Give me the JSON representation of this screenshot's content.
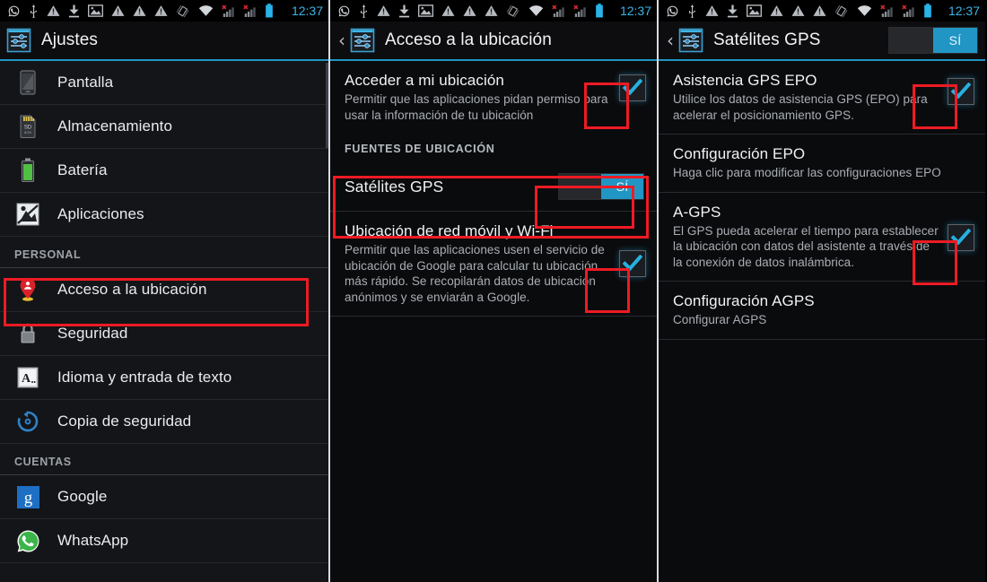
{
  "statusbar": {
    "time": "12:37",
    "icons": [
      "whatsapp-icon",
      "usb-icon",
      "warning-icon",
      "download-icon",
      "screenshot-icon",
      "warning-icon",
      "warning-icon",
      "warning-icon",
      "vibrate-icon",
      "wifi-icon",
      "signal-no-sim-1-icon",
      "signal-no-sim-2-icon",
      "battery-icon"
    ],
    "clock_color": "#3ab5e8"
  },
  "accent": "#2196c4",
  "highlight_color": "#ee1b24",
  "panel1": {
    "title": "Ajustes",
    "items": [
      {
        "label": "Pantalla",
        "icon": "display-icon"
      },
      {
        "label": "Almacenamiento",
        "icon": "sdcard-icon"
      },
      {
        "label": "Batería",
        "icon": "battery-icon"
      },
      {
        "label": "Aplicaciones",
        "icon": "apps-icon"
      }
    ],
    "section_personal": "PERSONAL",
    "personal_items": [
      {
        "label": "Acceso a la ubicación",
        "icon": "location-pin-icon",
        "highlighted": true
      },
      {
        "label": "Seguridad",
        "icon": "lock-icon",
        "highlighted": false
      },
      {
        "label": "Idioma y entrada de texto",
        "icon": "language-icon",
        "highlighted": false
      },
      {
        "label": "Copia de seguridad",
        "icon": "backup-icon",
        "highlighted": false
      }
    ],
    "section_cuentas": "CUENTAS",
    "account_items": [
      {
        "label": "Google",
        "icon": "google-icon"
      },
      {
        "label": "WhatsApp",
        "icon": "whatsapp-icon"
      }
    ]
  },
  "panel2": {
    "title": "Acceso a la ubicación",
    "back_icon": "back-chevron-icon",
    "pref_access": {
      "title": "Acceder a mi ubicación",
      "summary": "Permitir que las aplicaciones pidan permiso para usar la información de tu ubicación",
      "checked": true,
      "highlighted": true
    },
    "section_sources": "FUENTES DE UBICACIÓN",
    "pref_gps": {
      "title": "Satélites GPS",
      "toggle_on_label": "SÍ",
      "checked": true,
      "highlighted": true
    },
    "pref_network": {
      "title": "Ubicación de red móvil y Wi-Fi",
      "summary": "Permitir que las aplicaciones usen el servicio de ubicación de Google para calcular tu ubicación más rápido. Se recopilarán datos de ubicación anónimos y se enviarán a Google.",
      "checked": true,
      "highlighted": true
    }
  },
  "panel3": {
    "title": "Satélites GPS",
    "back_icon": "back-chevron-icon",
    "master_toggle_label": "SÍ",
    "master_toggle_on": true,
    "prefs": [
      {
        "title": "Asistencia GPS EPO",
        "summary": "Utilice los datos de asistencia GPS (EPO) para acelerar el posicionamiento GPS.",
        "has_checkbox": true,
        "checked": true,
        "highlighted": true
      },
      {
        "title": "Configuración EPO",
        "summary": "Haga clic para modificar las configuraciones EPO",
        "has_checkbox": false,
        "checked": false,
        "highlighted": false
      },
      {
        "title": "A-GPS",
        "summary": "El GPS pueda acelerar el tiempo para establecer la ubicación con datos del asistente a través de la conexión de datos inalámbrica.",
        "has_checkbox": true,
        "checked": true,
        "highlighted": true
      },
      {
        "title": "Configuración AGPS",
        "summary": "Configurar AGPS",
        "has_checkbox": false,
        "checked": false,
        "highlighted": false
      }
    ]
  }
}
